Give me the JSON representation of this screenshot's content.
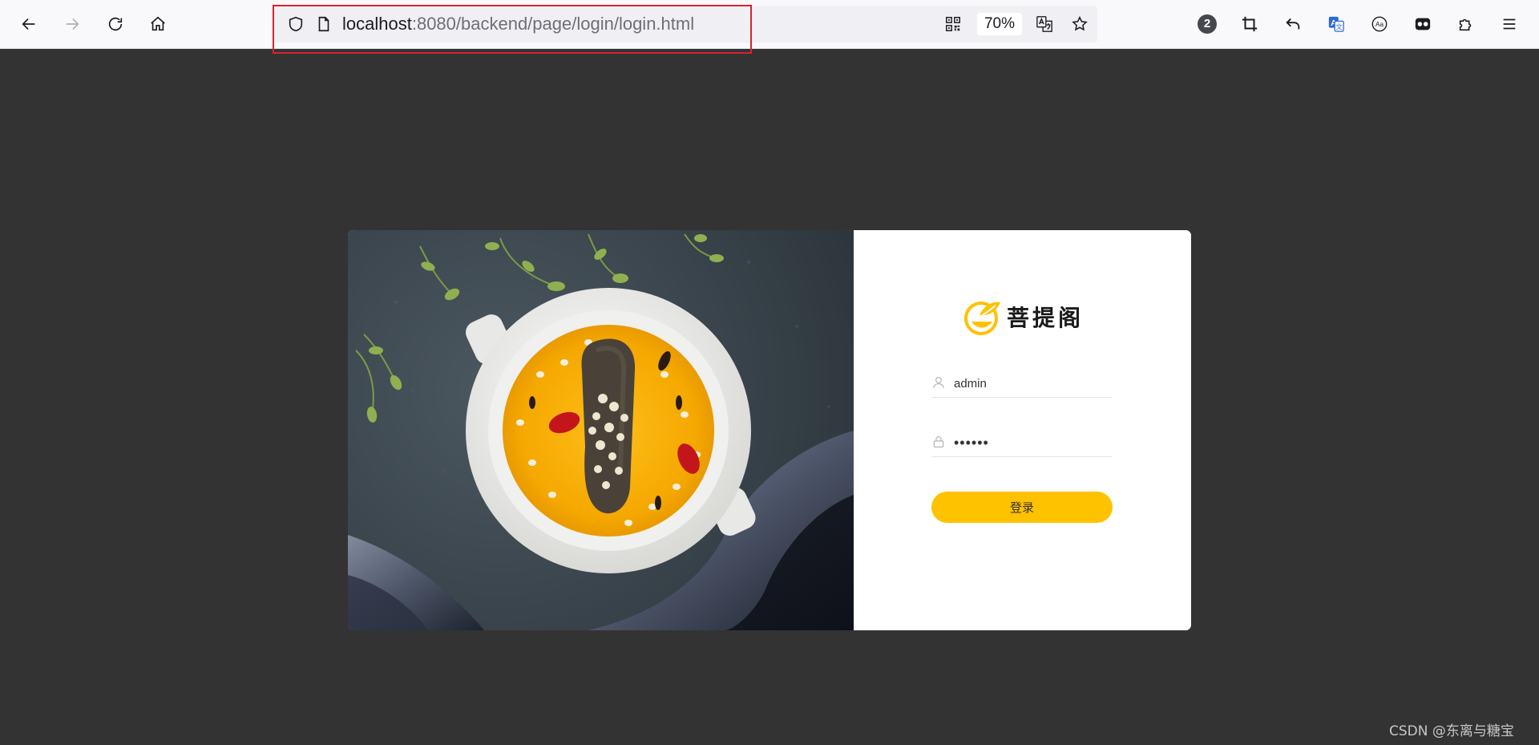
{
  "browser": {
    "url_host": "localhost",
    "url_rest": ":8080/backend/page/login/login.html",
    "zoom": "70%",
    "extension_badge": "2"
  },
  "login": {
    "brand": "菩提阁",
    "username_value": "admin",
    "password_value": "••••••",
    "login_button": "登录"
  },
  "watermark": "CSDN @东离与糖宝",
  "colors": {
    "accent": "#ffc200",
    "page_bg": "#333333",
    "url_highlight": "#d9232e"
  }
}
